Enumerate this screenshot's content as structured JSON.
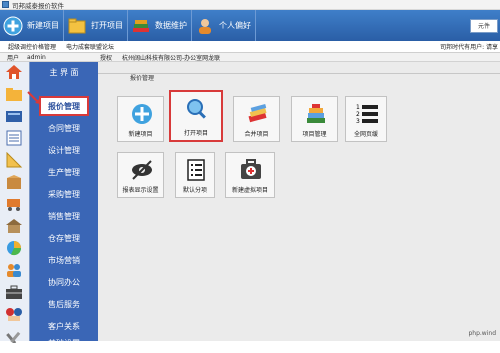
{
  "window": {
    "title": "司邦威泰报价软件"
  },
  "toolbar": {
    "buttons": [
      {
        "label": "新建项目",
        "icon": "plus-circle-icon"
      },
      {
        "label": "打开项目",
        "icon": "magnifier-icon"
      },
      {
        "label": "数据维护",
        "icon": "books-icon"
      },
      {
        "label": "个人偏好",
        "icon": "person-icon"
      }
    ],
    "right_box": "元件"
  },
  "infobar": {
    "left1": "超级调控价格管理",
    "left2": "电力成套联盟论坛",
    "right": "司邦时代有用户: 请享"
  },
  "userbar": {
    "user_label": "用户",
    "user_value": "admin",
    "perm_label": "授权",
    "perm_value": "杭州阔山科技有限公司-办公室网龙联"
  },
  "sidebar": {
    "items": [
      {
        "label": "主 界 面",
        "icon": "home-icon"
      },
      {
        "label": "报价管理",
        "icon": "folder-icon"
      },
      {
        "label": "合同管理",
        "icon": "book-icon"
      },
      {
        "label": "设计管理",
        "icon": "ledger-icon"
      },
      {
        "label": "生产管理",
        "icon": "triangle-ruler-icon"
      },
      {
        "label": "采购管理",
        "icon": "box-icon"
      },
      {
        "label": "销售管理",
        "icon": "cart-icon"
      },
      {
        "label": "仓存管理",
        "icon": "warehouse-icon"
      },
      {
        "label": "市场营销",
        "icon": "pie-chart-icon"
      },
      {
        "label": "协同办公",
        "icon": "people-icon"
      },
      {
        "label": "售后服务",
        "icon": "toolbox-icon"
      },
      {
        "label": "客户关系",
        "icon": "handshake-icon"
      },
      {
        "label": "基础设置",
        "icon": "wrench-icon"
      }
    ]
  },
  "content": {
    "breadcrumb": "报价管理",
    "tiles": [
      {
        "label": "新建项目",
        "icon": "plus-circle-icon"
      },
      {
        "label": "打开项目",
        "icon": "magnifier-icon"
      },
      {
        "label": "合并项目",
        "icon": "merge-icon"
      },
      {
        "label": "项目管理",
        "icon": "stack-books-icon"
      },
      {
        "label": "全网页缓",
        "icon": "numbered-list-icon"
      },
      {
        "label": "报表显示设置",
        "icon": "hidden-eye-icon"
      },
      {
        "label": "默认分项",
        "icon": "checklist-icon"
      },
      {
        "label": "新建虚拟项目",
        "icon": "medkit-icon"
      }
    ]
  },
  "watermark": "php.wind"
}
